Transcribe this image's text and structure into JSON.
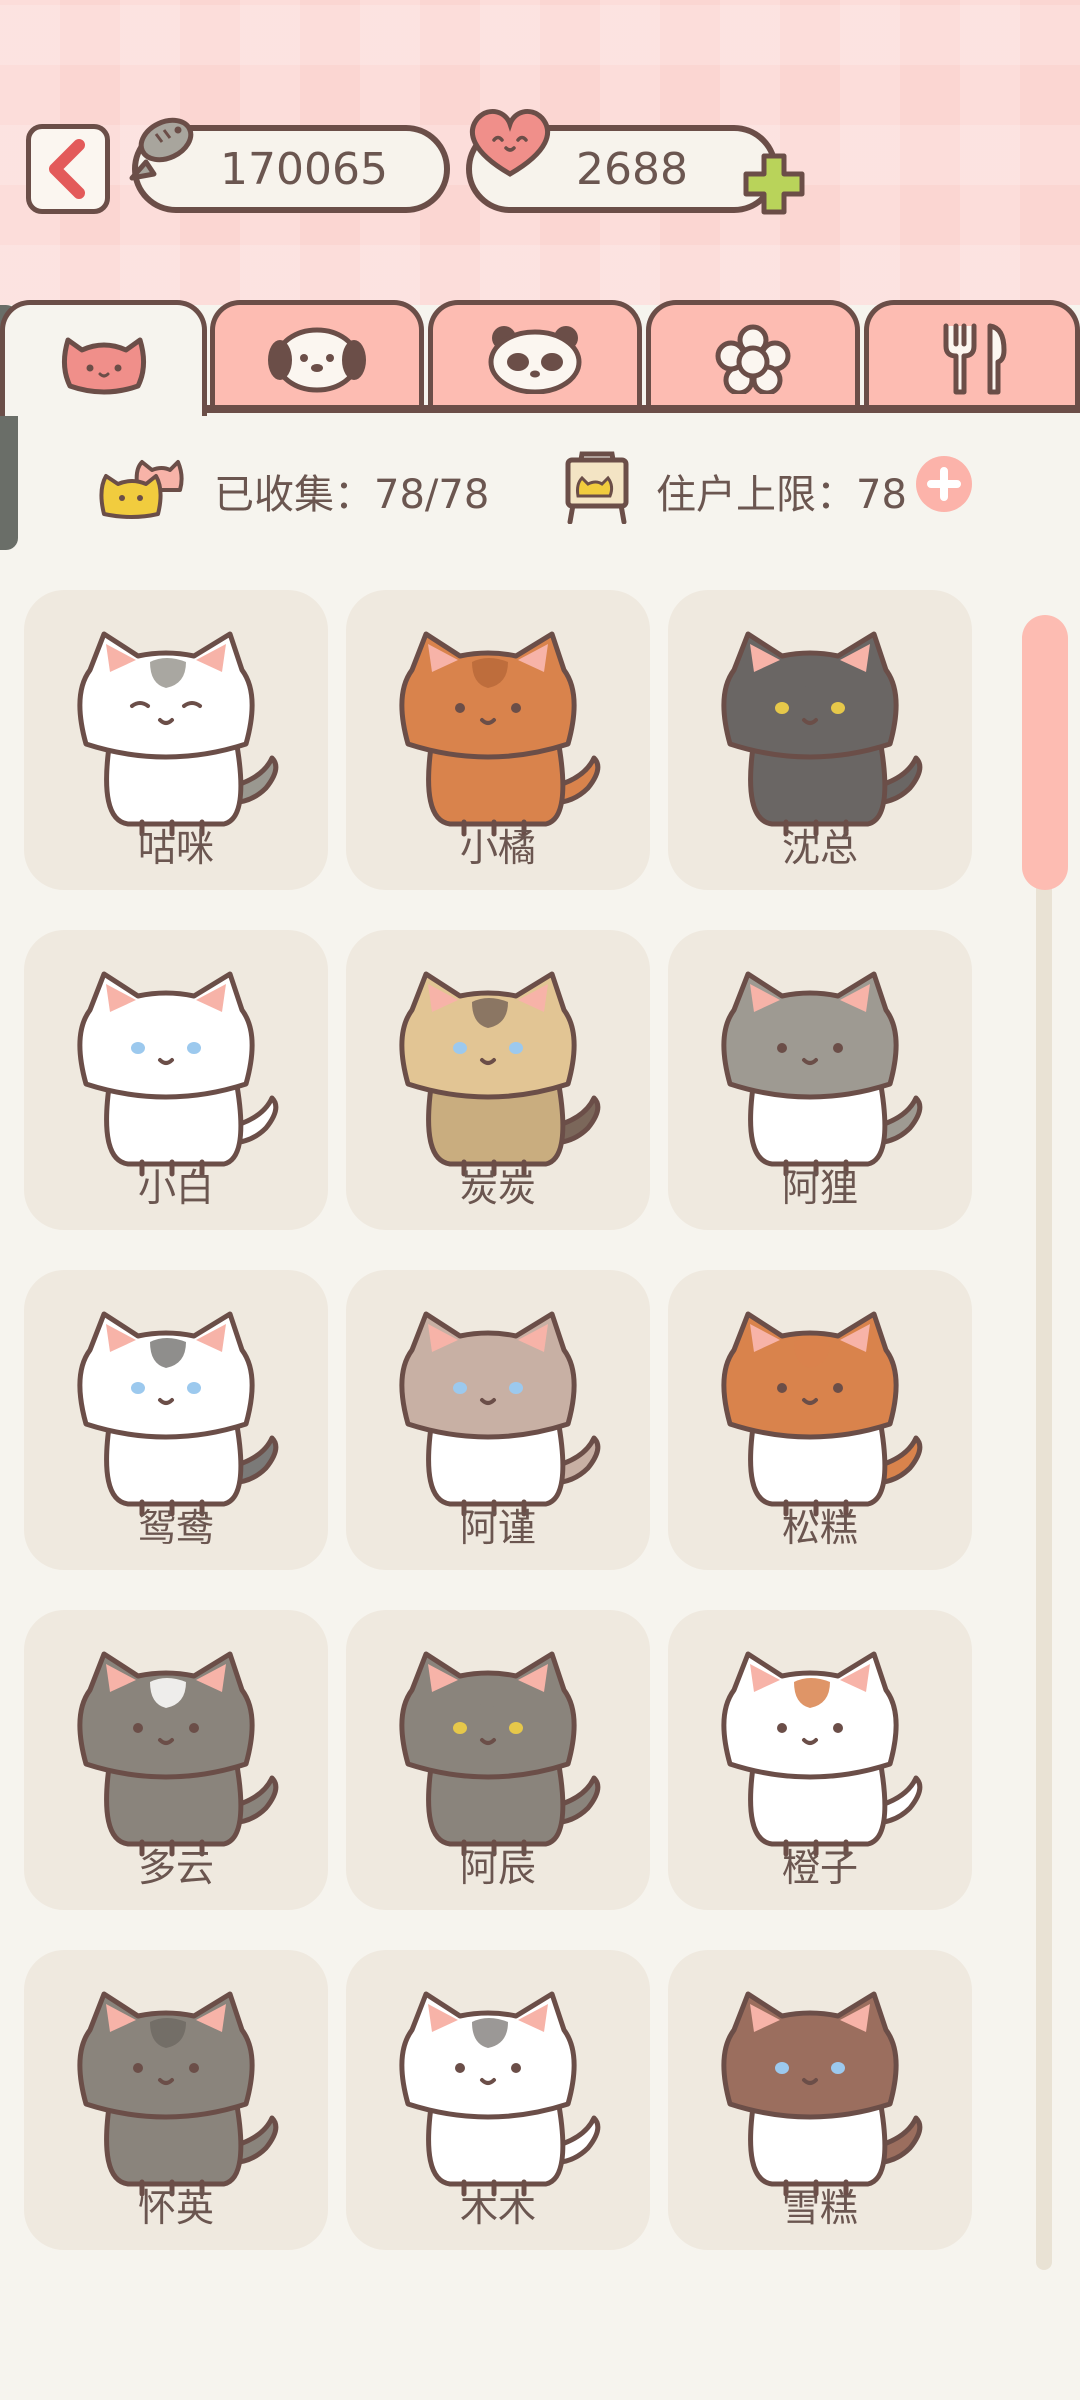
{
  "header": {
    "fish_count": "170065",
    "heart_count": "2688"
  },
  "tabs": [
    {
      "name": "cat-tab",
      "active": true
    },
    {
      "name": "dog-tab",
      "active": false
    },
    {
      "name": "panda-tab",
      "active": false
    },
    {
      "name": "flower-tab",
      "active": false
    },
    {
      "name": "food-tab",
      "active": false
    }
  ],
  "stats": {
    "collected_label": "已收集：78/78",
    "capacity_label": "住户上限：78"
  },
  "colors": {
    "accent_pink": "#fdbcb2",
    "outline_brown": "#6b4e48",
    "plus_green": "#b9d35a"
  },
  "cats": [
    {
      "name": "咕咪",
      "body": "#ffffff",
      "head": "#ffffff",
      "patch": "#9a9890",
      "eyes": "closed",
      "eye_color": "#5a4440",
      "tail": "#9a9890"
    },
    {
      "name": "小橘",
      "body": "#d9834c",
      "head": "#d9834c",
      "patch": "#b86a3a",
      "eyes": "dot",
      "eye_color": "#5a4440",
      "tail": "#d9834c"
    },
    {
      "name": "沈总",
      "body": "#6a6664",
      "head": "#6a6664",
      "patch": "#6a6664",
      "eyes": "yellow",
      "eye_color": "#e6c84a",
      "tail": "#6a6664"
    },
    {
      "name": "小白",
      "body": "#ffffff",
      "head": "#ffffff",
      "patch": "#ffffff",
      "eyes": "color",
      "eye_color": "#9cc9ee",
      "tail": "#ffffff"
    },
    {
      "name": "炭炭",
      "body": "#c9ad7f",
      "head": "#e2c594",
      "patch": "#7b675a",
      "eyes": "color",
      "eye_color": "#9cc9ee",
      "tail": "#7b675a"
    },
    {
      "name": "阿狸",
      "body": "#ffffff",
      "head": "#9e9a92",
      "patch": "#9e9a92",
      "eyes": "dot",
      "eye_color": "#5a4440",
      "tail": "#9e9a92"
    },
    {
      "name": "鸳鸯",
      "body": "#ffffff",
      "head": "#ffffff",
      "patch": "#7b7a78",
      "eyes": "color",
      "eye_color": "#9cc9ee",
      "tail": "#7b7a78"
    },
    {
      "name": "阿谨",
      "body": "#ffffff",
      "head": "#c8b0a4",
      "patch": "#c8b0a4",
      "eyes": "color",
      "eye_color": "#9cc9ee",
      "tail": "#c8b0a4"
    },
    {
      "name": "松糕",
      "body": "#ffffff",
      "head": "#d9834c",
      "patch": "#d9834c",
      "eyes": "dot",
      "eye_color": "#5a4440",
      "tail": "#d9834c"
    },
    {
      "name": "多云",
      "body": "#8a847c",
      "head": "#8a847c",
      "patch": "#ffffff",
      "eyes": "dot",
      "eye_color": "#5a4440",
      "tail": "#8a847c"
    },
    {
      "name": "阿辰",
      "body": "#8a847c",
      "head": "#8a847c",
      "patch": "#8a847c",
      "eyes": "yellow",
      "eye_color": "#e6c84a",
      "tail": "#8a847c"
    },
    {
      "name": "橙子",
      "body": "#ffffff",
      "head": "#ffffff",
      "patch": "#d9834c",
      "eyes": "dot",
      "eye_color": "#5a4440",
      "tail": "#ffffff"
    },
    {
      "name": "怀英",
      "body": "#8a847c",
      "head": "#8a847c",
      "patch": "#6e6a64",
      "eyes": "dot",
      "eye_color": "#5a4440",
      "tail": "#8a847c"
    },
    {
      "name": "木木",
      "body": "#ffffff",
      "head": "#ffffff",
      "patch": "#8a8684",
      "eyes": "dot",
      "eye_color": "#5a4440",
      "tail": "#ffffff"
    },
    {
      "name": "雪糕",
      "body": "#ffffff",
      "head": "#9b6e5e",
      "patch": "#9b6e5e",
      "eyes": "color",
      "eye_color": "#9cc9ee",
      "tail": "#9b6e5e"
    }
  ]
}
